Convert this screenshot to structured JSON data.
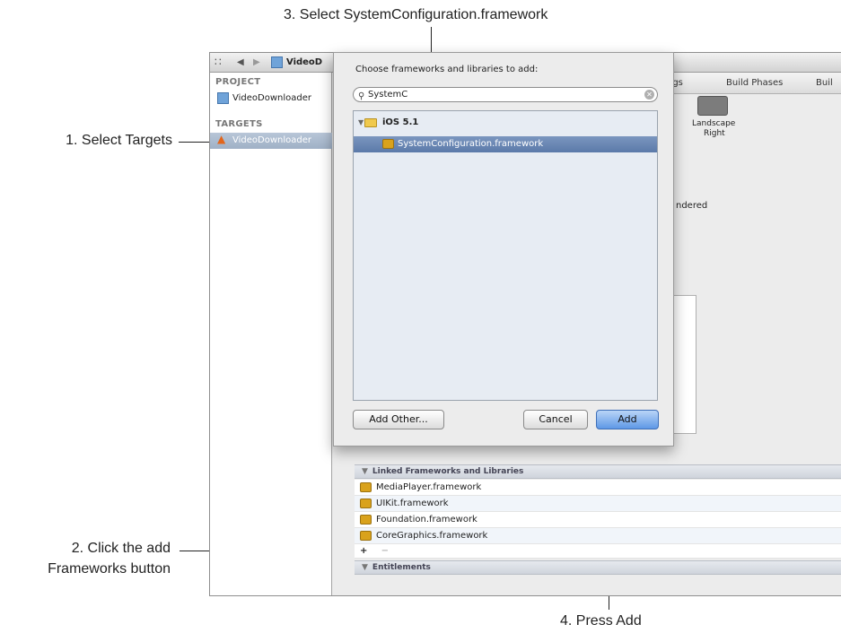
{
  "callouts": {
    "step1": "1. Select Targets",
    "step2_line1": "2. Click the add",
    "step2_line2": "Frameworks button",
    "step3": "3. Select SystemConfiguration.framework",
    "step4": "4. Press Add"
  },
  "toolbar": {
    "grid_icon": "grid-icon",
    "back_icon": "back-arrow-icon",
    "forward_icon": "forward-arrow-icon",
    "breadcrumb": "VideoD"
  },
  "navigator": {
    "project_header": "PROJECT",
    "project_item": "VideoDownloader",
    "targets_header": "TARGETS",
    "target_item": "VideoDownloader"
  },
  "editor": {
    "tabs": [
      "ngs",
      "Build Phases",
      "Buil"
    ],
    "landscape_label_1": "Landscape",
    "landscape_label_2": "Right",
    "partial_text": "ndered"
  },
  "linked_frameworks": {
    "header": "Linked Frameworks and Libraries",
    "items": [
      "MediaPlayer.framework",
      "UIKit.framework",
      "Foundation.framework",
      "CoreGraphics.framework"
    ],
    "add_label": "+",
    "remove_label": "−"
  },
  "entitlements": {
    "header": "Entitlements"
  },
  "sheet": {
    "title": "Choose frameworks and libraries to add:",
    "search_value": "SystemC",
    "group_label": "iOS 5.1",
    "selected_item": "SystemConfiguration.framework",
    "add_other_label": "Add Other...",
    "cancel_label": "Cancel",
    "add_label": "Add"
  }
}
